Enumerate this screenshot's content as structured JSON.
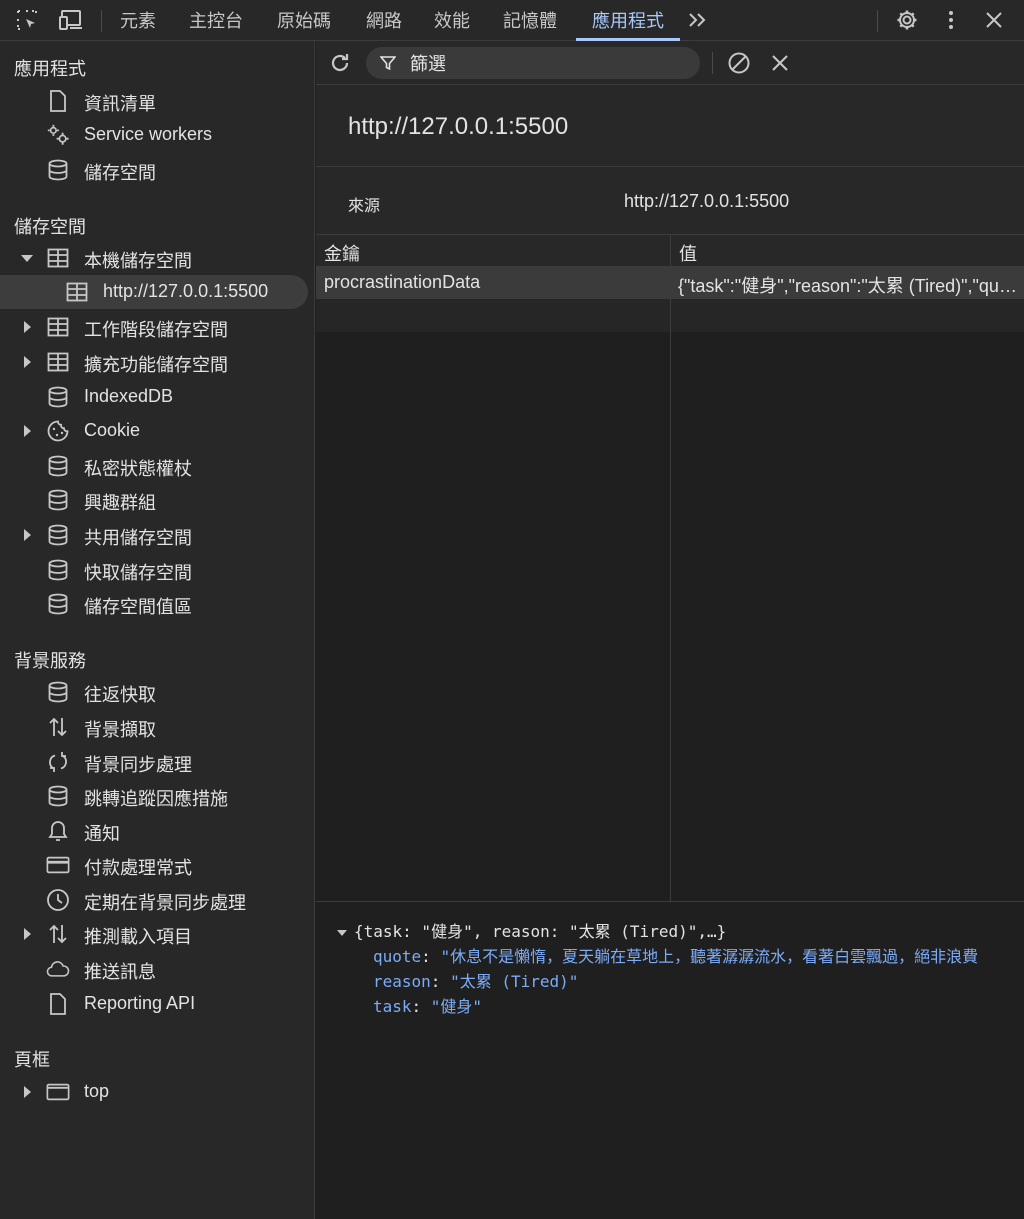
{
  "tabs": [
    {
      "label": "元素"
    },
    {
      "label": "主控台"
    },
    {
      "label": "原始碼"
    },
    {
      "label": "網路"
    },
    {
      "label": "效能"
    },
    {
      "label": "記憶體"
    },
    {
      "label": "應用程式"
    }
  ],
  "icons": {
    "inspect": "inspect-element-icon",
    "device": "device-toolbar-icon",
    "more_tabs": "chevron-double-right-icon",
    "settings": "gear-icon",
    "kebab": "more-vertical-icon",
    "close": "close-icon"
  },
  "colors": {
    "accent": "#a8c7fa",
    "link_blue": "#7cacf8",
    "panel_bg": "#282828",
    "selected_row": "#3b3b3b"
  },
  "sidebar": {
    "application": {
      "title": "應用程式",
      "items": [
        {
          "label": "資訊清單",
          "icon": "file-icon"
        },
        {
          "label": "Service workers",
          "icon": "gears-icon"
        },
        {
          "label": "儲存空間",
          "icon": "database-icon"
        }
      ]
    },
    "storage": {
      "title": "儲存空間",
      "items": [
        {
          "label": "本機儲存空間",
          "icon": "table-icon",
          "expanded": true
        },
        {
          "label": "http://127.0.0.1:5500",
          "icon": "table-icon",
          "selected": true
        },
        {
          "label": "工作階段儲存空間",
          "icon": "table-icon"
        },
        {
          "label": "擴充功能儲存空間",
          "icon": "table-icon"
        },
        {
          "label": "IndexedDB",
          "icon": "database-icon"
        },
        {
          "label": "Cookie",
          "icon": "cookie-icon"
        },
        {
          "label": "私密狀態權杖",
          "icon": "database-icon"
        },
        {
          "label": "興趣群組",
          "icon": "database-icon"
        },
        {
          "label": "共用儲存空間",
          "icon": "database-icon"
        },
        {
          "label": "快取儲存空間",
          "icon": "database-icon"
        },
        {
          "label": "儲存空間值區",
          "icon": "database-icon"
        }
      ]
    },
    "background": {
      "title": "背景服務",
      "items": [
        {
          "label": "往返快取",
          "icon": "database-icon"
        },
        {
          "label": "背景擷取",
          "icon": "arrows-updown-icon"
        },
        {
          "label": "背景同步處理",
          "icon": "sync-icon"
        },
        {
          "label": "跳轉追蹤因應措施",
          "icon": "database-icon"
        },
        {
          "label": "通知",
          "icon": "bell-icon"
        },
        {
          "label": "付款處理常式",
          "icon": "credit-card-icon"
        },
        {
          "label": "定期在背景同步處理",
          "icon": "clock-icon"
        },
        {
          "label": "推測載入項目",
          "icon": "arrows-updown-icon"
        },
        {
          "label": "推送訊息",
          "icon": "cloud-icon"
        },
        {
          "label": "Reporting API",
          "icon": "file-icon"
        }
      ]
    },
    "frames": {
      "title": "頁框",
      "items": [
        {
          "label": "top",
          "icon": "window-icon"
        }
      ]
    }
  },
  "toolbar": {
    "filter_placeholder": "篩選"
  },
  "origin": {
    "heading": "http://127.0.0.1:5500",
    "source_label": "來源",
    "source_value": "http://127.0.0.1:5500"
  },
  "table": {
    "headers": [
      "金鑰",
      "值"
    ],
    "rows": [
      {
        "key": "procrastinationData",
        "value": "{\"task\":\"健身\",\"reason\":\"太累 (Tired)\",\"quote\":\"休息不是懶惰，夏天躺在草地上，聽著潺潺流水，看著白雲飄過，絕非浪費"
      }
    ]
  },
  "preview": {
    "summary": "{task: \"健身\", reason: \"太累 (Tired)\",…}",
    "props": [
      {
        "key": "quote",
        "value": "\"休息不是懶惰，夏天躺在草地上，聽著潺潺流水，看著白雲飄過，絕非浪費"
      },
      {
        "key": "reason",
        "value": "\"太累 (Tired)\""
      },
      {
        "key": "task",
        "value": "\"健身\""
      }
    ]
  }
}
